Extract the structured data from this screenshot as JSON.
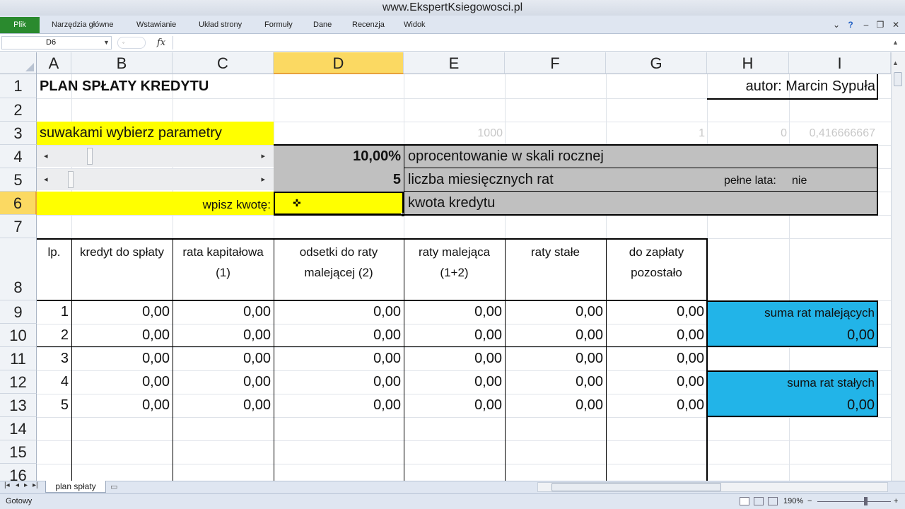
{
  "window": {
    "title": "www.EkspertKsiegowosci.pl"
  },
  "ribbon": {
    "file_label": "Plik",
    "tabs": [
      "Narzędzia główne",
      "Wstawianie",
      "Układ strony",
      "Formuły",
      "Dane",
      "Recenzja",
      "Widok"
    ]
  },
  "formula_bar": {
    "name_box": "D6",
    "fx": "fx",
    "value": ""
  },
  "columns": [
    "A",
    "B",
    "C",
    "D",
    "E",
    "F",
    "G",
    "H",
    "I"
  ],
  "rows": [
    "1",
    "2",
    "3",
    "4",
    "5",
    "6",
    "7",
    "8",
    "9",
    "10",
    "11",
    "12",
    "13",
    "14",
    "15",
    "16"
  ],
  "selected_cell": "D6",
  "sheet": {
    "title": "PLAN SPŁATY KREDYTU",
    "author": "autor: Marcin Sypuła",
    "instruction": "suwakami wybierz parametry",
    "helper_values": [
      "1000",
      "1",
      "0",
      "0,416666667"
    ],
    "interest_rate": "10,00%",
    "interest_label": "oprocentowanie w skali rocznej",
    "installments_count": "5",
    "installments_label": "liczba miesięcznych rat",
    "full_years_label": "pełne lata:",
    "full_years_value": "nie",
    "amount_prompt": "wpisz kwotę:",
    "amount_value": "",
    "amount_label": "kwota kredytu",
    "slider_interest_position": 0.2,
    "slider_installments_position": 0.1
  },
  "table": {
    "headers": [
      [
        "lp.",
        ""
      ],
      [
        "kredyt do spłaty",
        ""
      ],
      [
        "rata kapitałowa",
        "(1)"
      ],
      [
        "odsetki do raty",
        "malejącej (2)"
      ],
      [
        "raty malejąca",
        "(1+2)"
      ],
      [
        "raty stałe",
        ""
      ],
      [
        "do zapłaty",
        "pozostało"
      ]
    ],
    "rows": [
      [
        "1",
        "0,00",
        "0,00",
        "0,00",
        "0,00",
        "0,00",
        "0,00"
      ],
      [
        "2",
        "0,00",
        "0,00",
        "0,00",
        "0,00",
        "0,00",
        "0,00"
      ],
      [
        "3",
        "0,00",
        "0,00",
        "0,00",
        "0,00",
        "0,00",
        "0,00"
      ],
      [
        "4",
        "0,00",
        "0,00",
        "0,00",
        "0,00",
        "0,00",
        "0,00"
      ],
      [
        "5",
        "0,00",
        "0,00",
        "0,00",
        "0,00",
        "0,00",
        "0,00"
      ]
    ]
  },
  "summary": {
    "decreasing_label": "suma rat malejących",
    "decreasing_value": "0,00",
    "fixed_label": "suma rat stałych",
    "fixed_value": "0,00"
  },
  "sheet_tabs": [
    "plan spłaty"
  ],
  "status": {
    "ready": "Gotowy",
    "zoom": "190%"
  }
}
